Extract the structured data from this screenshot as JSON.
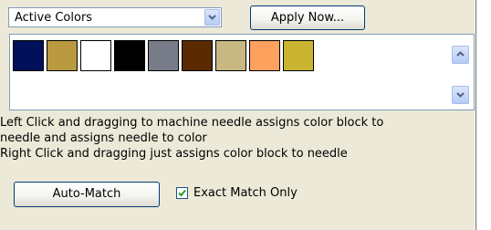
{
  "dropdown": {
    "value": "Active Colors"
  },
  "apply_button": {
    "label": "Apply Now..."
  },
  "palette": {
    "colors": [
      "#00105a",
      "#b99a40",
      "#ffffff",
      "#000000",
      "#787c88",
      "#5c2a00",
      "#c7b882",
      "#ffa15e",
      "#c9b530"
    ]
  },
  "instructions": {
    "line1": "Left Click and dragging to machine needle assigns color block to",
    "line2": "needle and assigns needle to color",
    "line3": "Right Click and dragging just assigns color block to needle"
  },
  "automatch_button": {
    "label": "Auto-Match"
  },
  "exact_match": {
    "label": "Exact Match Only",
    "checked": true
  }
}
